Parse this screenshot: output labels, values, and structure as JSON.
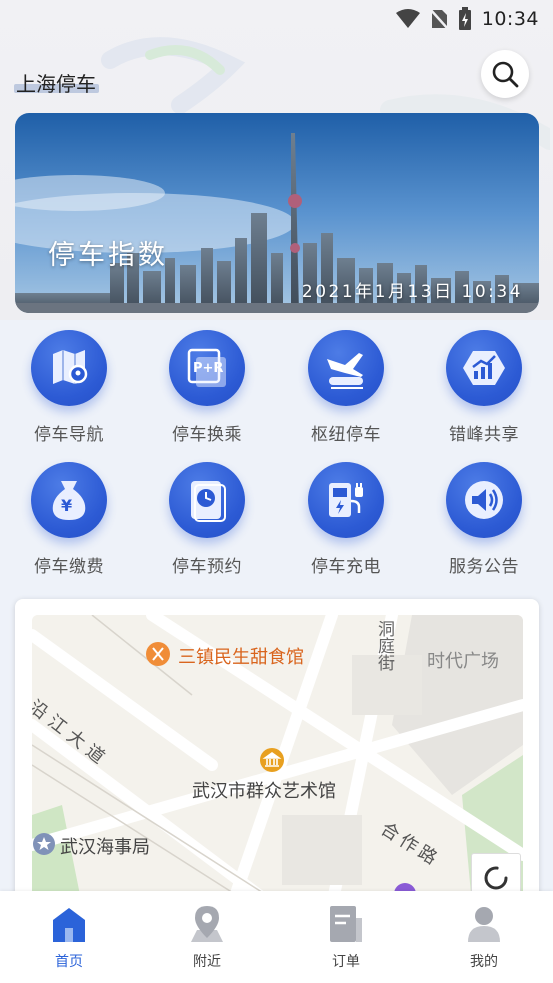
{
  "status_bar": {
    "time": "10:34"
  },
  "header": {
    "title": "上海停车"
  },
  "banner": {
    "title": "停车指数",
    "datetime": "2021年1月13日 10:34"
  },
  "grid": [
    {
      "label": "停车导航",
      "icon": "map-pin-icon"
    },
    {
      "label": "停车换乘",
      "icon": "park-ride-icon"
    },
    {
      "label": "枢纽停车",
      "icon": "train-plane-icon"
    },
    {
      "label": "错峰共享",
      "icon": "chart-share-icon"
    },
    {
      "label": "停车缴费",
      "icon": "money-bag-icon"
    },
    {
      "label": "停车预约",
      "icon": "clock-document-icon"
    },
    {
      "label": "停车充电",
      "icon": "charging-station-icon"
    },
    {
      "label": "服务公告",
      "icon": "speaker-icon"
    }
  ],
  "map": {
    "labels": {
      "restaurant": "三镇民生甜食馆",
      "street_vertical": "洞庭街",
      "plaza": "时代广场",
      "riverside": "沿江大道",
      "museum": "武汉市群众艺术馆",
      "maritime": "武汉海事局",
      "road": "合作路"
    }
  },
  "tabbar": [
    {
      "label": "首页",
      "icon": "home-icon",
      "active": true
    },
    {
      "label": "附近",
      "icon": "location-icon",
      "active": false
    },
    {
      "label": "订单",
      "icon": "order-icon",
      "active": false
    },
    {
      "label": "我的",
      "icon": "user-icon",
      "active": false
    }
  ],
  "colors": {
    "primary": "#2c5ad4",
    "active_tab": "#2b63d9"
  }
}
